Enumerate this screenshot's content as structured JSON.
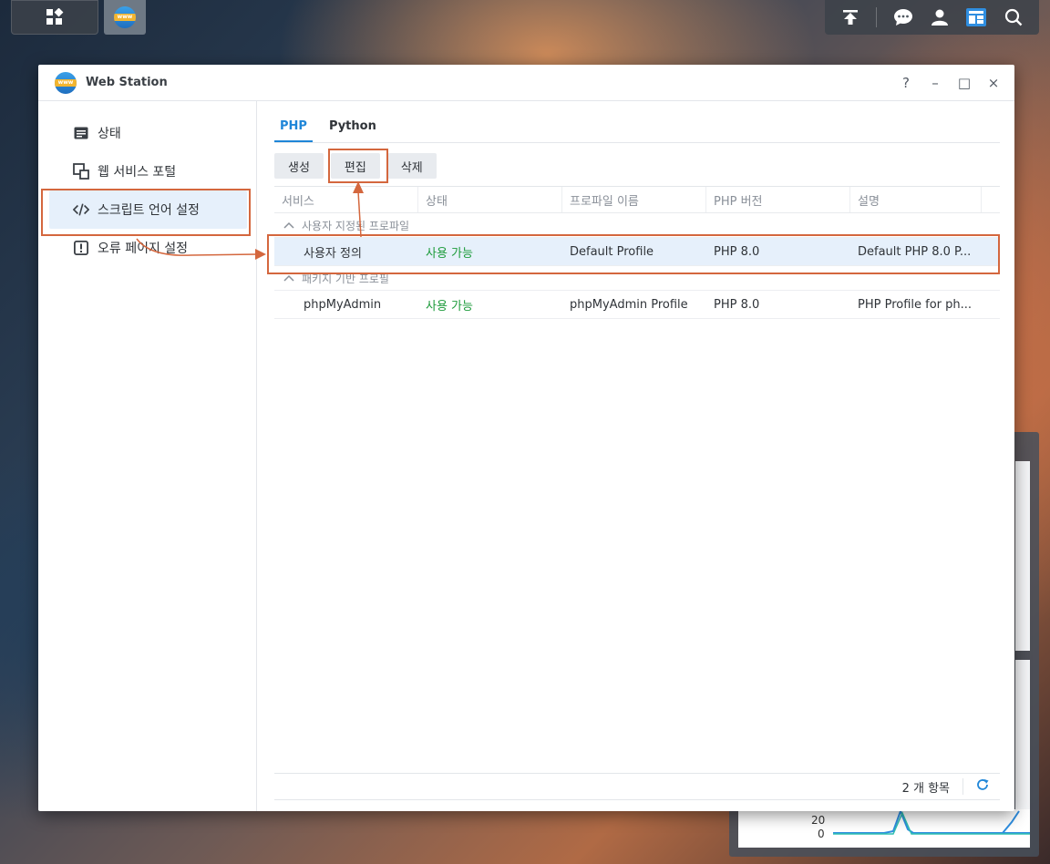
{
  "window": {
    "title": "Web Station",
    "controls": [
      "?",
      "–",
      "□",
      "×"
    ]
  },
  "sidebar": {
    "items": [
      {
        "label": "상태",
        "icon": "status-icon"
      },
      {
        "label": "웹 서비스 포털",
        "icon": "portal-icon"
      },
      {
        "label": "스크립트 언어 설정",
        "icon": "code-icon",
        "active": true
      },
      {
        "label": "오류 페이지 설정",
        "icon": "error-icon"
      }
    ]
  },
  "tabs": [
    {
      "label": "PHP",
      "active": true
    },
    {
      "label": "Python",
      "active": false
    }
  ],
  "toolbar": {
    "create_label": "생성",
    "edit_label": "편집",
    "delete_label": "삭제"
  },
  "grid": {
    "columns": [
      "서비스",
      "상태",
      "프로파일 이름",
      "PHP 버전",
      "설명"
    ],
    "groups": [
      {
        "label": "사용자 지정된 프로파일",
        "rows": [
          {
            "service": "사용자 정의",
            "status": "사용 가능",
            "profile": "Default Profile",
            "version": "PHP 8.0",
            "description": "Default PHP 8.0 P..."
          }
        ]
      },
      {
        "label": "패키지 기반 프로필",
        "rows": [
          {
            "service": "phpMyAdmin",
            "status": "사용 가능",
            "profile": "phpMyAdmin Profile",
            "version": "PHP 8.0",
            "description": "PHP Profile for ph..."
          }
        ]
      }
    ]
  },
  "footer": {
    "count_label": "2 개 항목"
  },
  "widget": {
    "label_20": "20",
    "label_0": "0"
  },
  "colors": {
    "accent": "#1f86d8",
    "status_ok": "#1d9b3b",
    "annotation": "#d4673e"
  }
}
